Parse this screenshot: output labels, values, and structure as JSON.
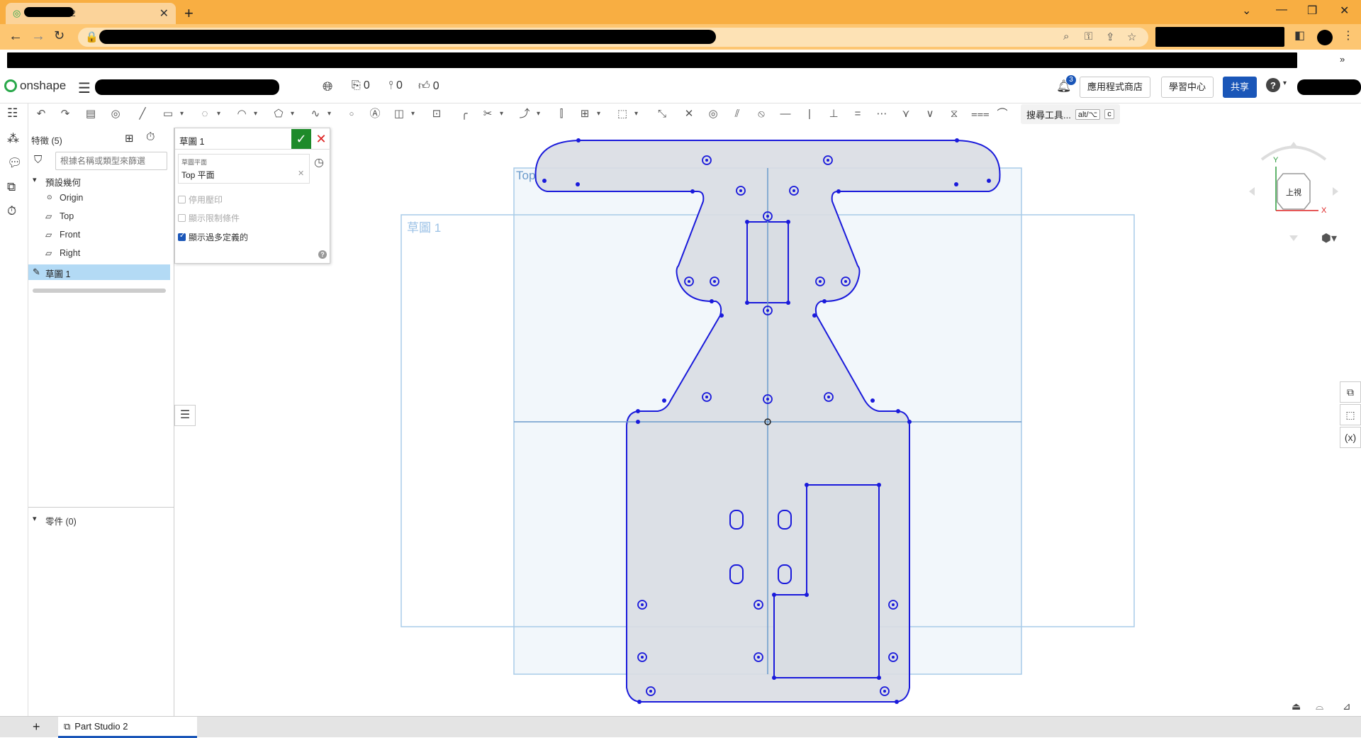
{
  "browser": {
    "tab_title": "Part Studio 2",
    "tab_close": "✕",
    "new_tab": "+",
    "win_min": "⌄",
    "win_minimize": "—",
    "win_restore": "❐",
    "win_close": "✕"
  },
  "header": {
    "logo_text": "onshape",
    "versions_count": "0",
    "branch_count": "0",
    "likes_count": "0",
    "notifications_count": "3",
    "app_store_label": "應用程式商店",
    "learning_center_label": "學習中心",
    "share_label": "共享",
    "help_label": "?"
  },
  "toolbar": {
    "search_tools_label": "搜尋工具...",
    "search_tools_shortcut_1": "alt/⌥",
    "search_tools_shortcut_2": "c"
  },
  "feature_panel": {
    "header_label": "特徵 (5)",
    "filter_placeholder": "根據名稱或類型來篩選",
    "default_geometry_label": "預設幾何",
    "origin_label": "Origin",
    "top_label": "Top",
    "front_label": "Front",
    "right_label": "Right",
    "sketch_label": "草圖 1",
    "parts_label": "零件 (0)"
  },
  "sketch_dialog": {
    "title": "草圖 1",
    "plane_field_label": "草圖平面",
    "plane_value": "Top 平面",
    "opt_disable_imprint": "停用壓印",
    "opt_show_constraints": "顯示限制條件",
    "opt_show_overdefined": "顯示過多定義的",
    "opt_disable_imprint_checked": false,
    "opt_show_constraints_checked": false,
    "opt_show_overdefined_checked": true
  },
  "canvas": {
    "top_plane_label": "Top",
    "sketch_label": "草圖 1",
    "sketch_color": "#1a1adb",
    "plane_color": "#a8cbe8"
  },
  "view_cube": {
    "face_label": "上視",
    "axis_y": "Y",
    "axis_x": "X"
  },
  "bottom": {
    "tab_label": "Part Studio 2"
  }
}
